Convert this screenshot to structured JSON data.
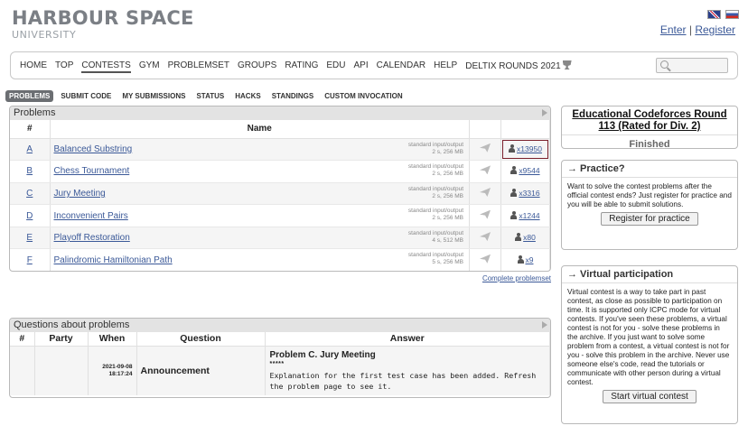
{
  "header": {
    "logo_main": "HARBOUR SPACE",
    "logo_sub": "UNIVERSITY",
    "enter_label": "Enter",
    "separator": "|",
    "register_label": "Register",
    "flags": [
      "uk-flag-icon",
      "ru-flag-icon"
    ]
  },
  "main_menu": {
    "items": [
      "HOME",
      "TOP",
      "CONTESTS",
      "GYM",
      "PROBLEMSET",
      "GROUPS",
      "RATING",
      "EDU",
      "API",
      "CALENDAR",
      "HELP",
      "DELTIX ROUNDS 2021"
    ],
    "active": "CONTESTS",
    "trophy_icon": "trophy-icon",
    "search_icon": "search-icon"
  },
  "sub_menu": {
    "items": [
      "PROBLEMS",
      "SUBMIT CODE",
      "MY SUBMISSIONS",
      "STATUS",
      "HACKS",
      "STANDINGS",
      "CUSTOM INVOCATION"
    ],
    "active": "PROBLEMS"
  },
  "problems_panel": {
    "title": "Problems",
    "col_index": "#",
    "col_name": "Name",
    "rows": [
      {
        "index": "A",
        "name": "Balanced Substring",
        "io": "standard input/output",
        "limits": "2 s, 256 MB",
        "solved": "x13950",
        "highlighted": true
      },
      {
        "index": "B",
        "name": "Chess Tournament",
        "io": "standard input/output",
        "limits": "2 s, 256 MB",
        "solved": "x9544",
        "highlighted": false
      },
      {
        "index": "C",
        "name": "Jury Meeting",
        "io": "standard input/output",
        "limits": "2 s, 256 MB",
        "solved": "x3316",
        "highlighted": false
      },
      {
        "index": "D",
        "name": "Inconvenient Pairs",
        "io": "standard input/output",
        "limits": "2 s, 256 MB",
        "solved": "x1244",
        "highlighted": false
      },
      {
        "index": "E",
        "name": "Playoff Restoration",
        "io": "standard input/output",
        "limits": "4 s, 512 MB",
        "solved": "x80",
        "highlighted": false
      },
      {
        "index": "F",
        "name": "Palindromic Hamiltonian Path",
        "io": "standard input/output",
        "limits": "5 s, 256 MB",
        "solved": "x9",
        "highlighted": false
      }
    ],
    "complete_link": "Complete problemset"
  },
  "questions_panel": {
    "title": "Questions about problems",
    "headers": [
      "#",
      "Party",
      "When",
      "Question",
      "Answer"
    ],
    "rows": [
      {
        "number": "",
        "party": "",
        "when_date": "2021-09-08",
        "when_time": "18:17:24",
        "question": "Announcement",
        "answer_title": "Problem C. Jury Meeting",
        "answer_stars": "*****",
        "answer_text": "Explanation for the first test case has been added. Refresh the problem page to see it."
      }
    ]
  },
  "sidebar": {
    "contest": {
      "title": "Educational Codeforces Round 113 (Rated for Div. 2)",
      "status": "Finished"
    },
    "practice": {
      "heading": "→ Practice?",
      "text": "Want to solve the contest problems after the official contest ends? Just register for practice and you will be able to submit solutions.",
      "button": "Register for practice"
    },
    "virtual": {
      "heading": "→ Virtual participation",
      "text": "Virtual contest is a way to take part in past contest, as close as possible to participation on time. It is supported only ICPC mode for virtual contests. If you've seen these problems, a virtual contest is not for you - solve these problems in the archive. If you just want to solve some problem from a contest, a virtual contest is not for you - solve this problem in the archive. Never use someone else's code, read the tutorials or communicate with other person during a virtual contest.",
      "button": "Start virtual contest"
    }
  }
}
